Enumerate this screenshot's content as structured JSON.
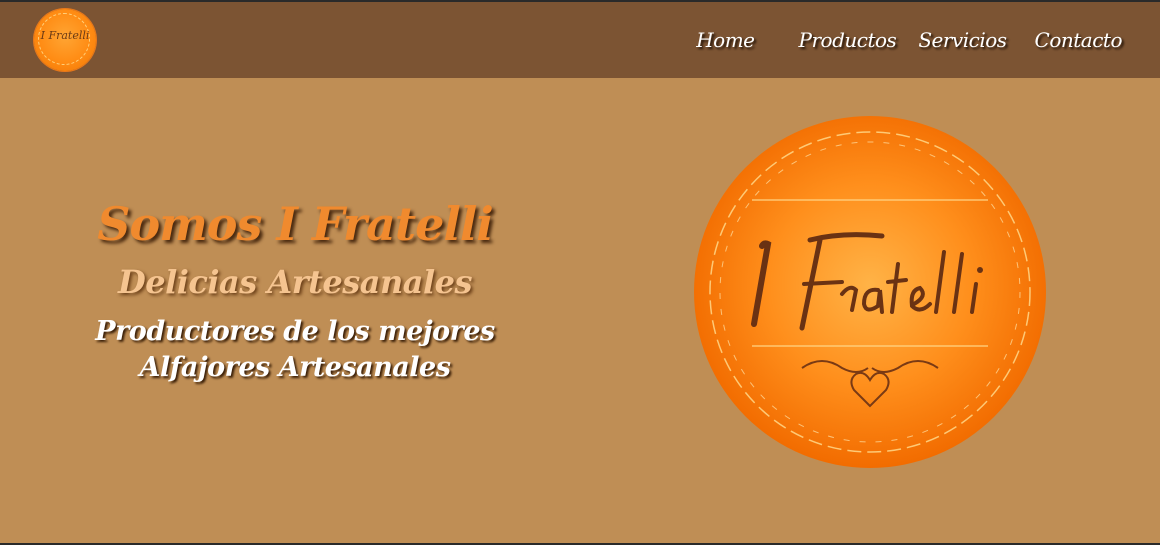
{
  "nav": {
    "logo_text": "I Fratelli",
    "items": [
      {
        "label": "Home"
      },
      {
        "label": "Productos"
      },
      {
        "label": "Servicios"
      },
      {
        "label": "Contacto"
      }
    ]
  },
  "hero": {
    "title": "Somos I Fratelli",
    "subtitle": "Delicias Artesanales",
    "description_line1": "Productores de los mejores",
    "description_line2": "Alfajores Artesanales",
    "logo_text": "I Fratelli"
  },
  "colors": {
    "navbar": "#7c5433",
    "background": "#bf8e55",
    "title": "#f08a2e",
    "subtitle": "#f5c490",
    "logo_orange": "#ff8c14"
  }
}
